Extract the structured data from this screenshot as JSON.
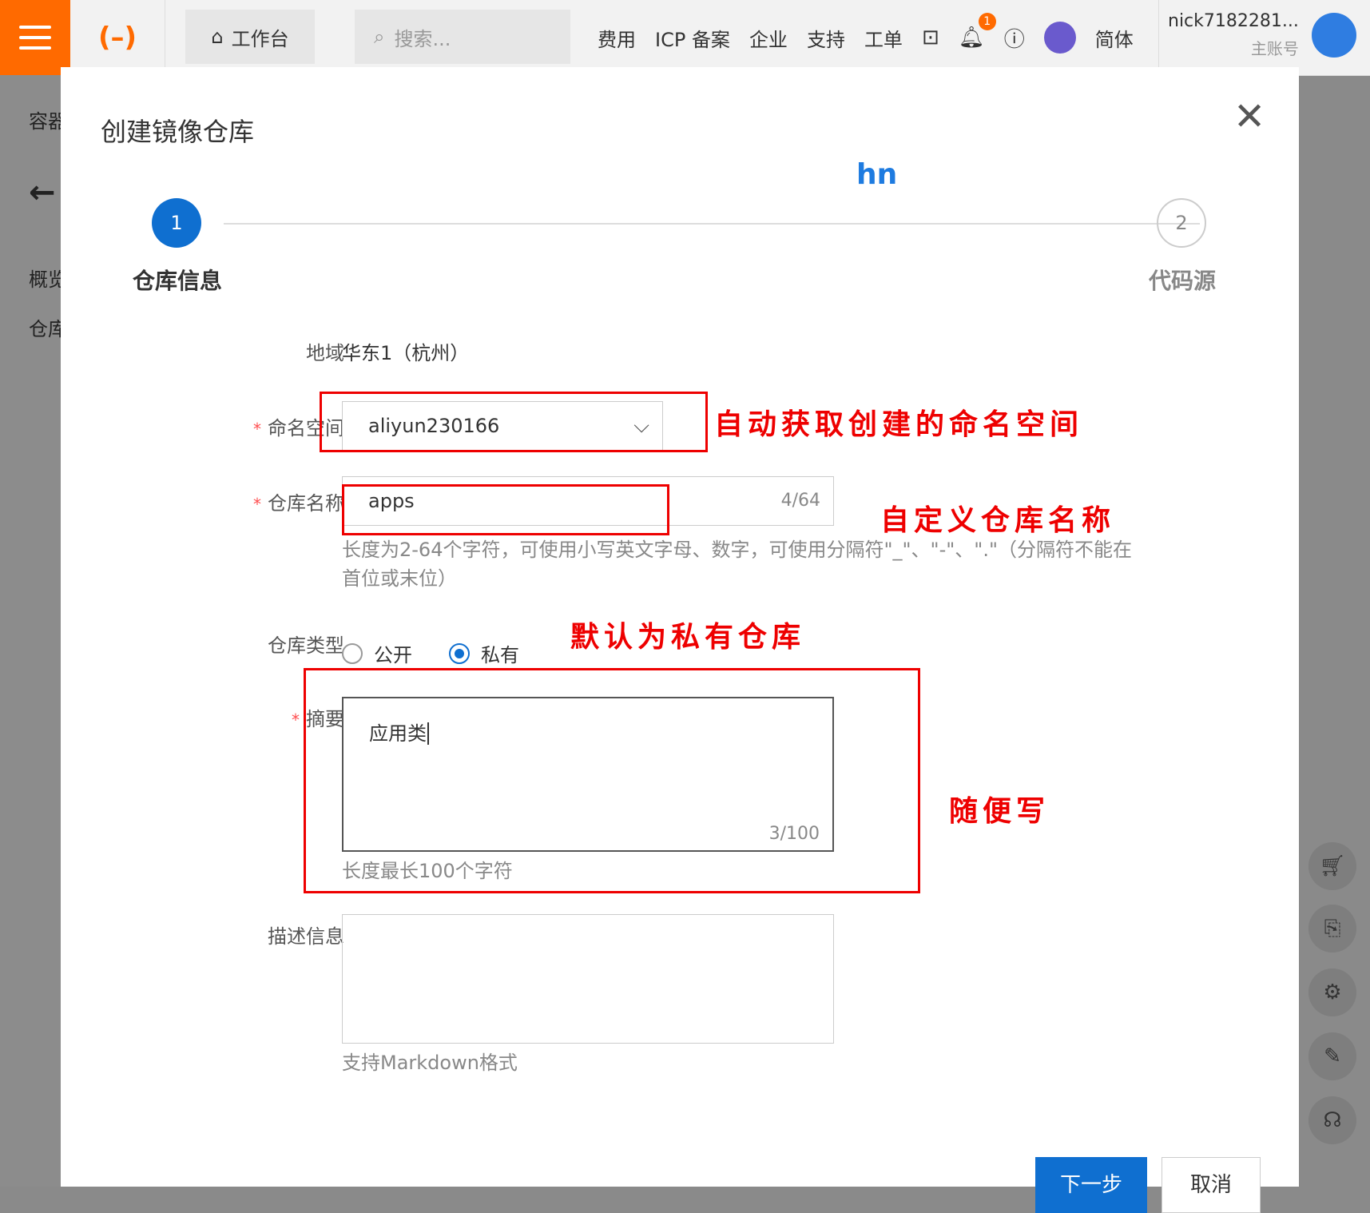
{
  "topbar": {
    "workbench_label": "工作台",
    "search_placeholder": "搜索...",
    "nav": [
      "费用",
      "ICP 备案",
      "企业",
      "支持",
      "工单"
    ],
    "bell_count": "1",
    "language": "简体",
    "username": "nick7182281...",
    "account_type": "主账号"
  },
  "background": {
    "side_labels": [
      "容器",
      "概览",
      "仓库"
    ]
  },
  "dialog": {
    "title": "创建镜像仓库",
    "close_symbol": "✕",
    "stray_text": "hn",
    "steps": [
      {
        "number": "1",
        "label": "仓库信息"
      },
      {
        "number": "2",
        "label": "代码源"
      }
    ],
    "fields": {
      "region": {
        "label": "地域",
        "value": "华东1（杭州）"
      },
      "namespace": {
        "label": "命名空间",
        "value": "aliyun230166"
      },
      "repo_name": {
        "label": "仓库名称",
        "value": "apps",
        "count": "4/64",
        "hint": "长度为2-64个字符，可使用小写英文字母、数字，可使用分隔符\"_\"、\"-\"、\".\"（分隔符不能在首位或末位）"
      },
      "repo_type": {
        "label": "仓库类型",
        "options": [
          "公开",
          "私有"
        ],
        "selected": "私有"
      },
      "summary": {
        "label": "摘要",
        "value": "应用类",
        "count": "3/100",
        "hint": "长度最长100个字符"
      },
      "description": {
        "label": "描述信息",
        "value": "",
        "hint": "支持Markdown格式"
      }
    },
    "buttons": {
      "next": "下一步",
      "cancel": "取消"
    }
  },
  "annotations": {
    "namespace": "自动获取创建的命名空间",
    "repo_name": "自定义仓库名称",
    "repo_type": "默认为私有仓库",
    "summary": "随便写"
  },
  "colors": {
    "brand": "#ff6a00",
    "primary": "#0f6fd0",
    "annotation": "#ee0000"
  }
}
